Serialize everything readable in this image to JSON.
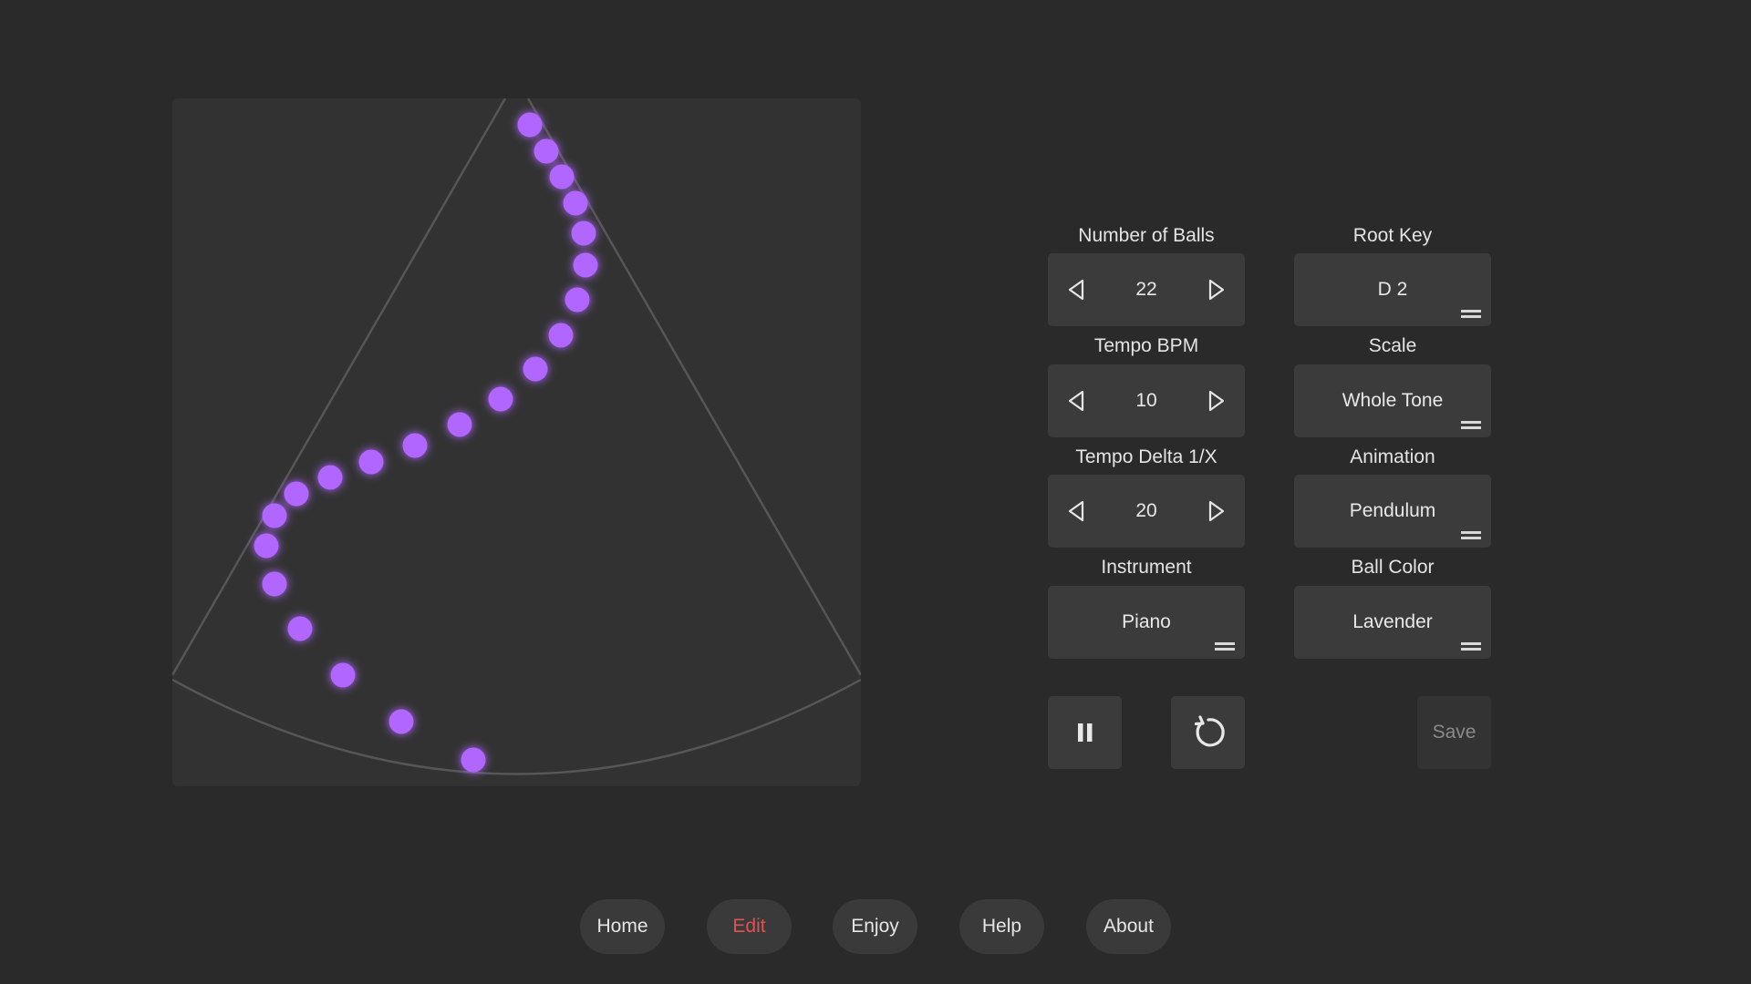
{
  "controls": {
    "num_balls": {
      "label": "Number of Balls",
      "value": "22"
    },
    "root_key": {
      "label": "Root Key",
      "value": "D 2"
    },
    "tempo_bpm": {
      "label": "Tempo BPM",
      "value": "10"
    },
    "scale": {
      "label": "Scale",
      "value": "Whole Tone"
    },
    "tempo_delta": {
      "label": "Tempo Delta 1/X",
      "value": "20"
    },
    "animation": {
      "label": "Animation",
      "value": "Pendulum"
    },
    "instrument": {
      "label": "Instrument",
      "value": "Piano"
    },
    "ball_color": {
      "label": "Ball Color",
      "value": "Lavender"
    }
  },
  "actions": {
    "pause_icon": "pause-icon",
    "reset_icon": "reset-icon",
    "save_label": "Save"
  },
  "nav": [
    {
      "label": "Home",
      "active": false
    },
    {
      "label": "Edit",
      "active": true
    },
    {
      "label": "Enjoy",
      "active": false
    },
    {
      "label": "Help",
      "active": false
    },
    {
      "label": "About",
      "active": false
    }
  ],
  "colors": {
    "background": "#2a2a2a",
    "panel": "#323232",
    "control": "#3b3b3b",
    "ball": "#b066ff",
    "active_nav": "#e05252"
  }
}
